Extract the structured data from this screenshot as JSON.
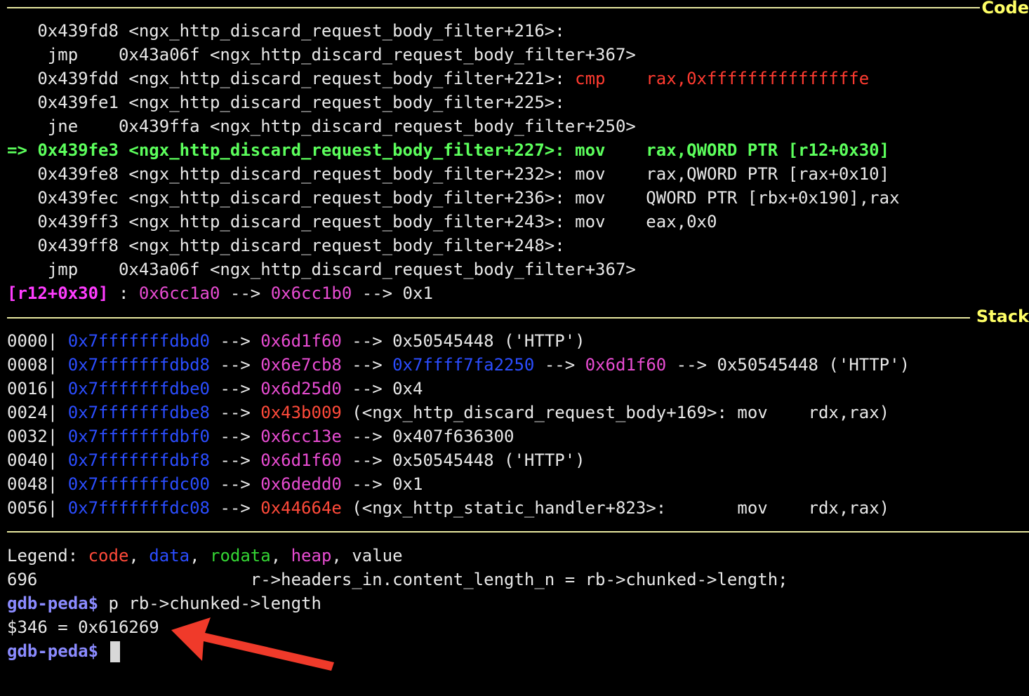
{
  "sections": {
    "code_title": "Code",
    "stack_title": "Stack"
  },
  "code": {
    "lines": [
      "   0x439fd8 <ngx_http_discard_request_body_filter+216>:",
      "    jmp    0x43a06f <ngx_http_discard_request_body_filter+367>",
      "   0x439fdd <ngx_http_discard_request_body_filter+221>: ",
      "   0x439fe1 <ngx_http_discard_request_body_filter+225>:",
      "    jne    0x439ffa <ngx_http_discard_request_body_filter+250>",
      "=> 0x439fe3 <ngx_http_discard_request_body_filter+227>: mov    rax,QWORD PTR [r12+0x30]",
      "   0x439fe8 <ngx_http_discard_request_body_filter+232>: mov    rax,QWORD PTR [rax+0x10]",
      "   0x439fec <ngx_http_discard_request_body_filter+236>: mov    QWORD PTR [rbx+0x190],rax",
      "   0x439ff3 <ngx_http_discard_request_body_filter+243>: mov    eax,0x0",
      "   0x439ff8 <ngx_http_discard_request_body_filter+248>:",
      "    jmp    0x43a06f <ngx_http_discard_request_body_filter+367>"
    ],
    "cmp_instr": "cmp    rax,0xfffffffffffffffe",
    "deref": {
      "expr": "[r12+0x30]",
      "sep": " : ",
      "addr1": "0x6cc1a0",
      "arrow": " --> ",
      "addr2": "0x6cc1b0",
      "value": "0x1"
    }
  },
  "stack": {
    "rows": [
      {
        "off": "0000| ",
        "addr": "0x7fffffffdbd0",
        "parts": [
          [
            "pink",
            "0x6d1f60"
          ],
          [
            "white",
            " --> 0x50545448 ('HTTP')"
          ]
        ]
      },
      {
        "off": "0008| ",
        "addr": "0x7fffffffdbd8",
        "parts": [
          [
            "pink",
            "0x6e7cb8"
          ],
          [
            "white",
            " --> "
          ],
          [
            "blue",
            "0x7ffff7fa2250"
          ],
          [
            "white",
            " --> "
          ],
          [
            "pink",
            "0x6d1f60"
          ],
          [
            "white",
            " --> 0x50545448 ('HTTP')"
          ]
        ]
      },
      {
        "off": "0016| ",
        "addr": "0x7fffffffdbe0",
        "parts": [
          [
            "pink",
            "0x6d25d0"
          ],
          [
            "white",
            " --> 0x4"
          ]
        ]
      },
      {
        "off": "0024| ",
        "addr": "0x7fffffffdbe8",
        "parts": [
          [
            "cred",
            "0x43b009"
          ],
          [
            "white",
            " (<ngx_http_discard_request_body+169>: mov    rdx,rax)"
          ]
        ]
      },
      {
        "off": "0032| ",
        "addr": "0x7fffffffdbf0",
        "parts": [
          [
            "pink",
            "0x6cc13e"
          ],
          [
            "white",
            " --> 0x407f636300"
          ]
        ]
      },
      {
        "off": "0040| ",
        "addr": "0x7fffffffdbf8",
        "parts": [
          [
            "pink",
            "0x6d1f60"
          ],
          [
            "white",
            " --> 0x50545448 ('HTTP')"
          ]
        ]
      },
      {
        "off": "0048| ",
        "addr": "0x7fffffffdc00",
        "parts": [
          [
            "pink",
            "0x6dedd0"
          ],
          [
            "white",
            " --> 0x1"
          ]
        ]
      },
      {
        "off": "0056| ",
        "addr": "0x7fffffffdc08",
        "parts": [
          [
            "cred",
            "0x44664e"
          ],
          [
            "white",
            " (<ngx_http_static_handler+823>:       mov    rdx,rax)"
          ]
        ]
      }
    ],
    "arrow": " --> "
  },
  "legend": {
    "label": "Legend: ",
    "code": "code",
    "data": "data",
    "rodata": "rodata",
    "heap": "heap",
    "value": "value",
    "comma": ", "
  },
  "console": {
    "source_line": "696                     r->headers_in.content_length_n = rb->chunked->length;",
    "prompt": "gdb-peda$",
    "command": " p rb->chunked->length",
    "result": "$346 = 0x616269"
  },
  "colors": {
    "background": "#000000",
    "separator": "#e8e8a0",
    "section_title": "#ffff66",
    "current_line": "#5cff5c",
    "code_color": "#ff4a3a",
    "data_color": "#2b4dff",
    "rodata_color": "#34d534",
    "heap_color": "#e84cd2",
    "prompt_color": "#8b8bff",
    "annotation_arrow": "#f03a2a"
  }
}
